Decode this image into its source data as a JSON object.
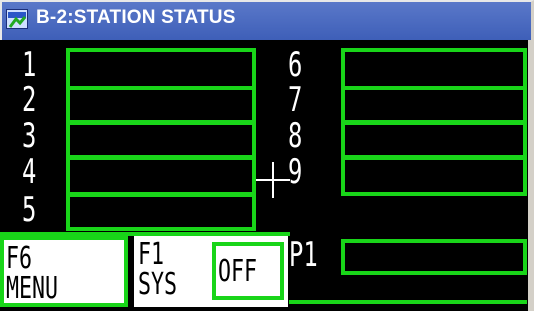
{
  "window": {
    "title": "B-2:STATION STATUS",
    "icon": "terminal-app-icon"
  },
  "stations_left": [
    {
      "number": "1"
    },
    {
      "number": "2"
    },
    {
      "number": "3"
    },
    {
      "number": "4"
    },
    {
      "number": "5"
    }
  ],
  "stations_right": [
    {
      "number": "6"
    },
    {
      "number": "7"
    },
    {
      "number": "8"
    },
    {
      "number": "9"
    }
  ],
  "printer": {
    "label": "P1"
  },
  "softkeys": {
    "f6": {
      "line1": "F6",
      "line2": "MENU"
    },
    "f1": {
      "line1": "F1",
      "line2": "SYS"
    },
    "sys_toggle": "OFF"
  },
  "colors": {
    "status_green": "#19d519",
    "title_bar": "#3e5fb8",
    "screen_bg": "#000000"
  }
}
